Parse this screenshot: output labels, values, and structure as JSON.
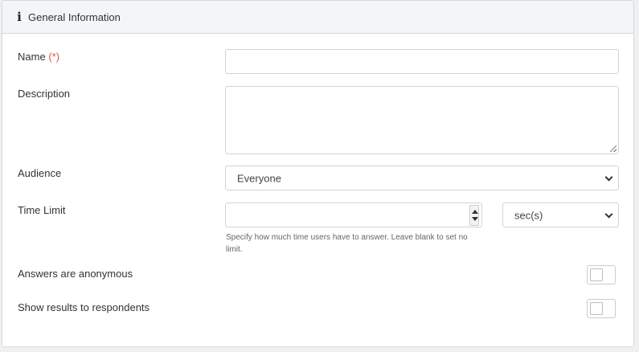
{
  "header": {
    "icon": "info-icon",
    "title": "General Information"
  },
  "form": {
    "name": {
      "label": "Name",
      "required_marker": "(*)",
      "value": "",
      "placeholder": ""
    },
    "description": {
      "label": "Description",
      "value": ""
    },
    "audience": {
      "label": "Audience",
      "selected": "Everyone"
    },
    "time_limit": {
      "label": "Time Limit",
      "value": "",
      "unit_selected": "sec(s)",
      "help": "Specify how much time users have to answer. Leave blank to set no limit."
    },
    "anonymous": {
      "label": "Answers are anonymous",
      "checked": false
    },
    "show_results": {
      "label": "Show results to respondents",
      "checked": false
    }
  },
  "colors": {
    "required": "#d9534f",
    "header_bg": "#f4f5f7",
    "border": "#cfd4da"
  }
}
